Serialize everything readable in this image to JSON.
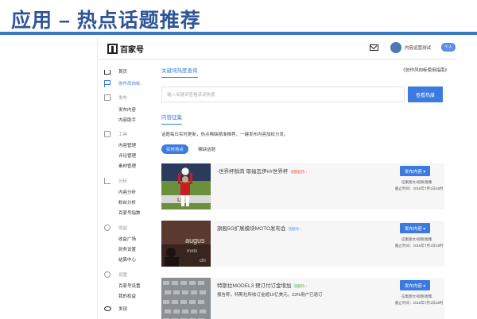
{
  "slide": {
    "title": "应用 – 热点话题推荐"
  },
  "topbar": {
    "logo_text": "百家号",
    "account_name": "内容运营测试",
    "account_badge": "个人",
    "mail_icon": "mail-icon"
  },
  "sidebar": {
    "items": [
      {
        "label": "首页",
        "icon": "home-icon",
        "group": false
      },
      {
        "label": "创作风向标",
        "icon": "flag-icon",
        "group": false,
        "active": true
      },
      {
        "label": "发布",
        "icon": "edit-icon",
        "group": true
      },
      {
        "label": "发布内容",
        "group": false
      },
      {
        "label": "内容助手",
        "group": false
      },
      {
        "label": "工具",
        "icon": "tool-icon",
        "group": true
      },
      {
        "label": "内容管理",
        "group": false
      },
      {
        "label": "评论管理",
        "group": false
      },
      {
        "label": "素材管理",
        "group": false
      },
      {
        "label": "分析",
        "icon": "chart-icon",
        "group": true
      },
      {
        "label": "内容分析",
        "group": false
      },
      {
        "label": "粉丝分析",
        "group": false
      },
      {
        "label": "百家号指数",
        "group": false
      },
      {
        "label": "收益",
        "icon": "money-icon",
        "group": true
      },
      {
        "label": "收益广场",
        "group": false
      },
      {
        "label": "财务设置",
        "group": false
      },
      {
        "label": "结算中心",
        "group": false
      },
      {
        "label": "设置",
        "icon": "gear-icon",
        "group": true
      },
      {
        "label": "百家号设置",
        "group": false
      },
      {
        "label": "我的权益",
        "group": false
      },
      {
        "label": "发现",
        "icon": "eye-icon",
        "group": false
      }
    ]
  },
  "main": {
    "keyword_tab": "关键词热度查询",
    "guide_link": "《创作风向标使用指南》",
    "search_placeholder": "输入关键词查看该词热度",
    "search_button": "查看热度",
    "collect_tab": "内容征集",
    "description": "话题每日实时更新，热点稀缺精准推荐，一键发布内容加权分发。",
    "chip_hot": "实时热点",
    "chip_soon": "稀缺话题",
    "cards": [
      {
        "title": "-世界杯鲜肉 耶福瓦伊##世界杯",
        "tag": "话题超热 ↑",
        "tag_color": "#e0584f",
        "desc": "",
        "button": "发布内容 ▾",
        "meta1": "征集图文/视频/图集",
        "meta2": "截止时间：2018年7月1日18时"
      },
      {
        "title": "旗舰5G扩展模块MOTO发布会",
        "tag": "话题热 ↑",
        "tag_color": "#5b8ee6",
        "desc": "",
        "button": "发布内容 ▾",
        "meta1": "征集图文/视频/图集",
        "meta2": "截止时间：2018年7月1日18时"
      },
      {
        "title": "特斯拉MODEL3 预订付订金增加",
        "tag": "话题热 ↓",
        "tag_color": "#4caf50",
        "desc": "报告称，特斯拉所收订金超10亿美元，23%用户已退订",
        "button": "发布内容 ▾",
        "meta1": "征集图文/视频/图集",
        "meta2": "截止时间：2018年7月1日18时"
      }
    ]
  },
  "colors": {
    "accent": "#3b7be0",
    "slide_title": "#2f5597",
    "rule": "#3b78c8"
  }
}
